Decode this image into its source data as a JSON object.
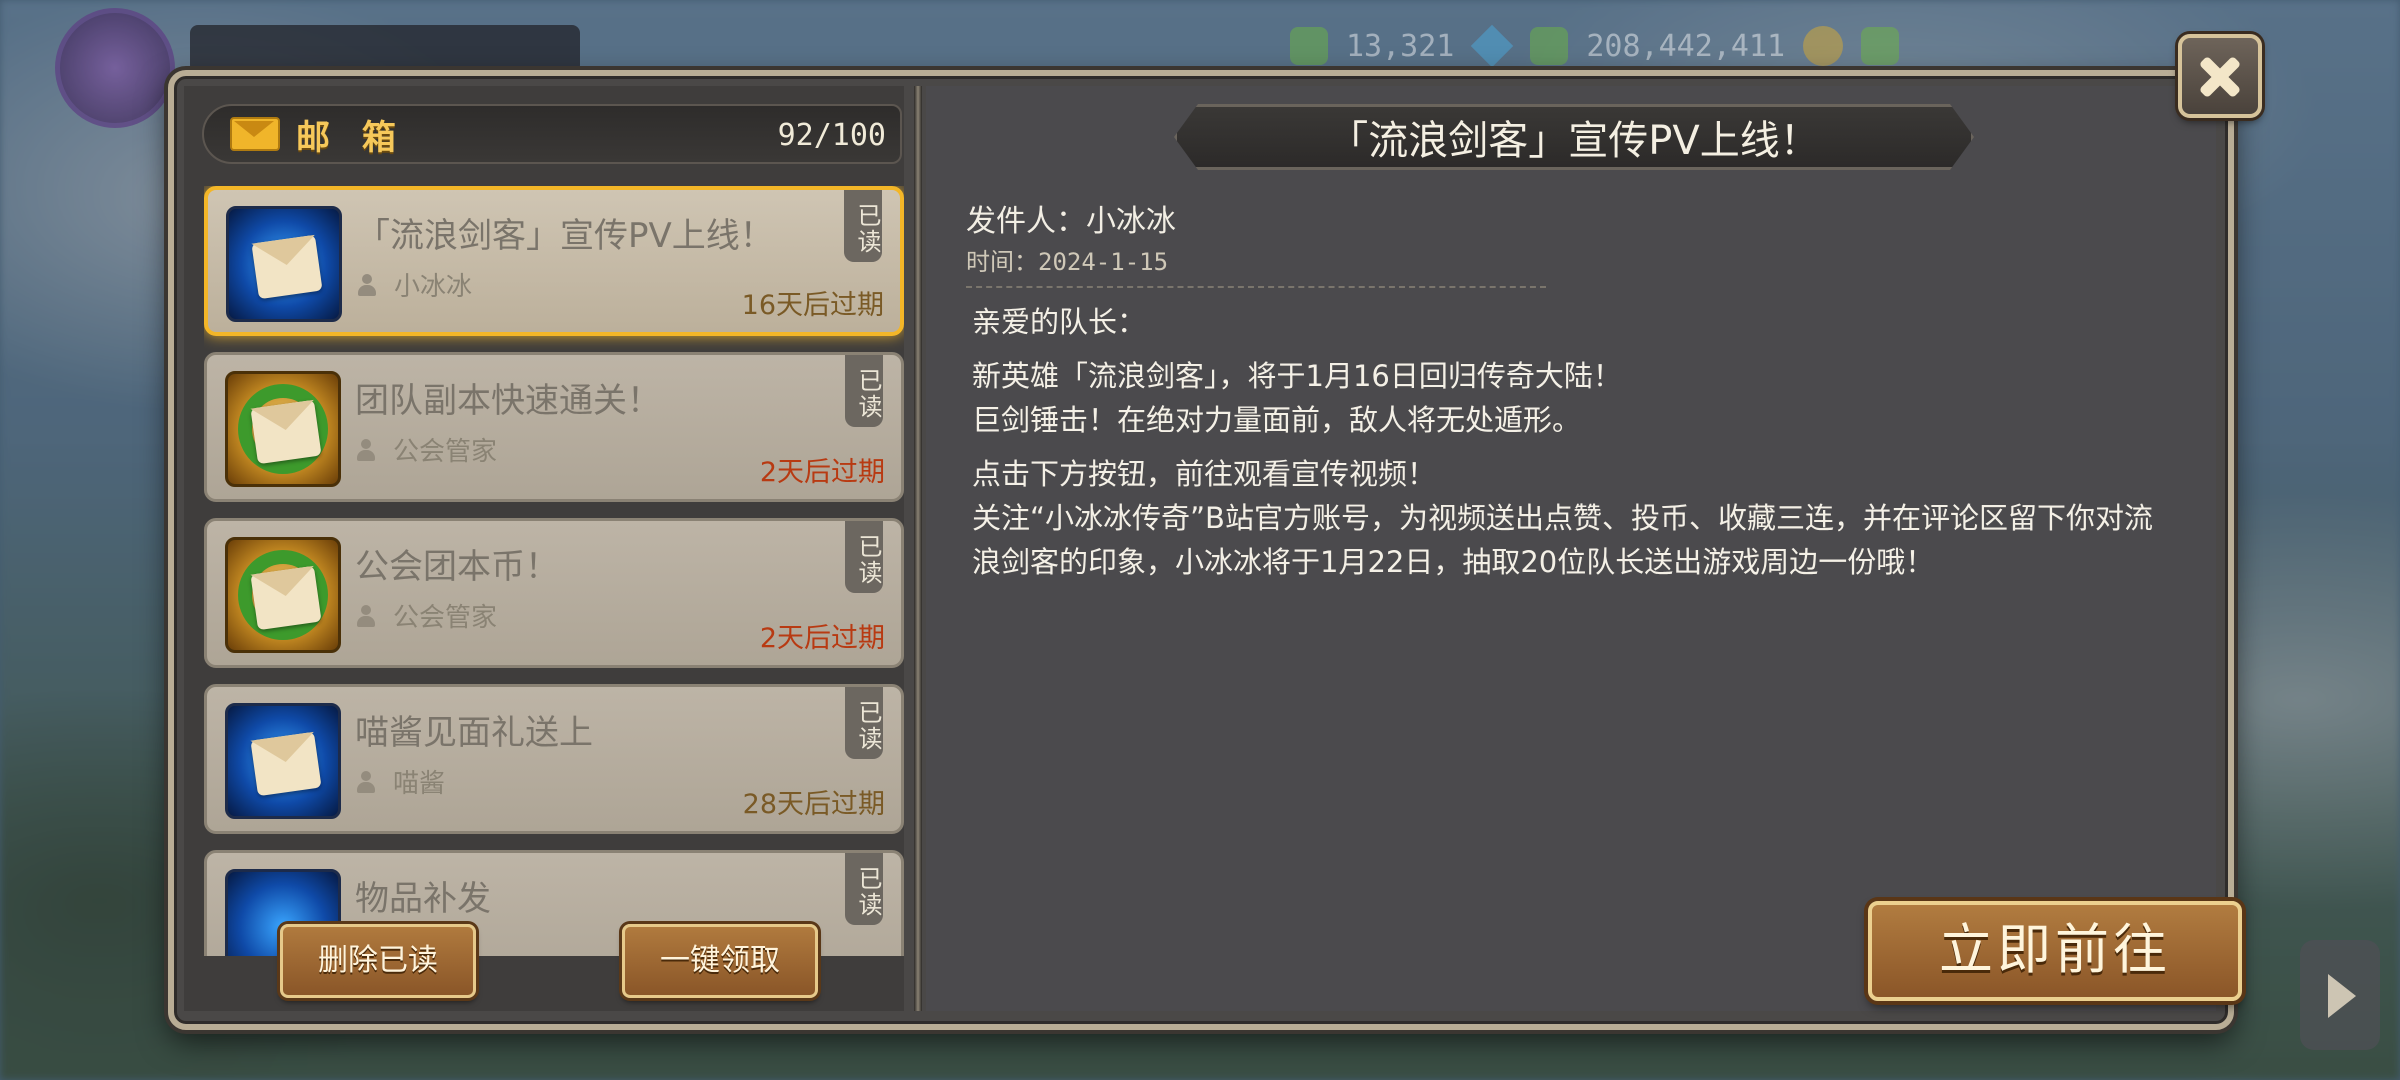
{
  "hud": {
    "diamonds": "13,321",
    "gold": "208,442,411"
  },
  "mailbox": {
    "title": "邮 箱",
    "count": "92/100",
    "items": [
      {
        "title": "「流浪剑客」宣传PV上线！",
        "sender": "小冰冰",
        "read_label": "已读",
        "expiry": "16天后过期",
        "icon": "envelope-blue-icon",
        "selected": true,
        "expiry_warn": false
      },
      {
        "title": "团队副本快速通关！",
        "sender": "公会管家",
        "read_label": "已读",
        "expiry": "2天后过期",
        "icon": "envelope-wreath-icon",
        "selected": false,
        "expiry_warn": true
      },
      {
        "title": "公会团本币！",
        "sender": "公会管家",
        "read_label": "已读",
        "expiry": "2天后过期",
        "icon": "envelope-wreath-icon",
        "selected": false,
        "expiry_warn": true
      },
      {
        "title": "喵酱见面礼送上",
        "sender": "喵酱",
        "read_label": "已读",
        "expiry": "28天后过期",
        "icon": "envelope-blue-icon",
        "selected": false,
        "expiry_warn": false
      },
      {
        "title": "物品补发",
        "sender": "",
        "read_label": "已读",
        "expiry": "",
        "icon": "item-icon",
        "selected": false,
        "expiry_warn": false
      }
    ],
    "delete_read_label": "删除已读",
    "claim_all_label": "一键领取"
  },
  "detail": {
    "subject": "「流浪剑客」宣传PV上线！",
    "sender_line": "发件人：小冰冰",
    "time_line": "时间：2024-1-15",
    "greeting": "亲爱的队长：",
    "para1": "新英雄「流浪剑客」，将于1月16日回归传奇大陆！",
    "para2": "巨剑锤击！在绝对力量面前，敌人将无处遁形。",
    "para3": "点击下方按钮，前往观看宣传视频！",
    "para4": "关注“小冰冰传奇”B站官方账号，为视频送出点赞、投币、收藏三连，并在评论区留下你对流浪剑客的印象，小冰冰将于1月22日，抽取20位队长送出游戏周边一份哦！",
    "go_label": "立即前往"
  },
  "colors": {
    "selected_border": "#f3b628",
    "expiry_warn": "#b83a12",
    "button_brown": "#8a5628"
  }
}
